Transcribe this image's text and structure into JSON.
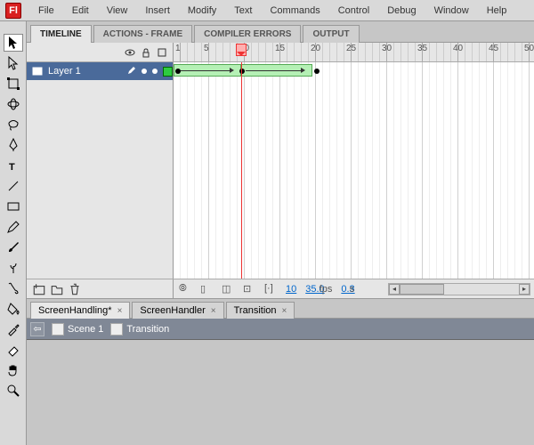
{
  "app": {
    "icon_letter": "Fl"
  },
  "menu": {
    "items": [
      "File",
      "Edit",
      "View",
      "Insert",
      "Modify",
      "Text",
      "Commands",
      "Control",
      "Debug",
      "Window",
      "Help"
    ]
  },
  "panel_tabs": [
    {
      "label": "TIMELINE",
      "active": true
    },
    {
      "label": "ACTIONS - FRAME",
      "active": false
    },
    {
      "label": "COMPILER ERRORS",
      "active": false
    },
    {
      "label": "OUTPUT",
      "active": false
    }
  ],
  "timeline": {
    "ruler_marks": [
      "1",
      "5",
      "10",
      "15",
      "20",
      "25",
      "30",
      "35",
      "40",
      "45",
      "50"
    ],
    "playhead_frame": 10,
    "layers": [
      {
        "name": "Layer 1",
        "selected": true
      }
    ],
    "status": {
      "frame": "10",
      "fps": "35.0",
      "time": "0.3"
    }
  },
  "doc_tabs": [
    {
      "label": "ScreenHandling*",
      "active": true
    },
    {
      "label": "ScreenHandler",
      "active": false
    },
    {
      "label": "Transition",
      "active": false
    }
  ],
  "breadcrumb": {
    "scene": "Scene 1",
    "symbol": "Transition"
  }
}
